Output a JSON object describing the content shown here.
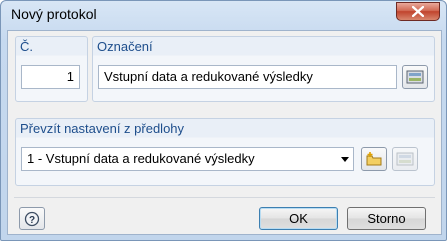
{
  "window": {
    "title": "Nový protokol"
  },
  "number_group": {
    "label": "Č.",
    "value": "1"
  },
  "designation_group": {
    "label": "Označení",
    "value": "Vstupní data a redukované výsledky"
  },
  "template_group": {
    "label": "Převzít nastavení z předlohy",
    "selected": "1 - Vstupní data a redukované výsledky"
  },
  "buttons": {
    "ok": "OK",
    "cancel": "Storno"
  }
}
